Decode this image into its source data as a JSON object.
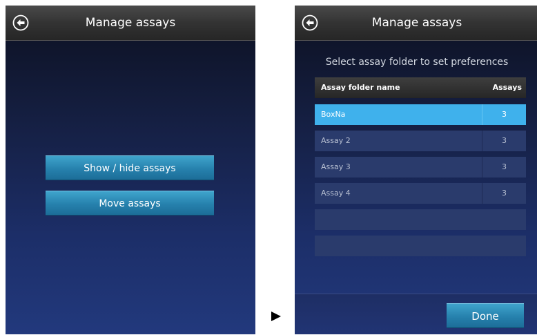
{
  "left_screen": {
    "title": "Manage assays",
    "back_icon": "back-arrow-circle-icon",
    "buttons": [
      {
        "label": "Show / hide assays"
      },
      {
        "label": "Move assays"
      }
    ]
  },
  "flow_arrow_icon": "right-triangle-icon",
  "right_screen": {
    "title": "Manage assays",
    "back_icon": "back-arrow-circle-icon",
    "subtitle": "Select assay folder to set preferences",
    "table": {
      "headers": {
        "name": "Assay folder name",
        "count": "Assays"
      },
      "rows": [
        {
          "name": "BoxNa",
          "count": "3",
          "selected": true
        },
        {
          "name": "Assay 2",
          "count": "3",
          "selected": false
        },
        {
          "name": "Assay 3",
          "count": "3",
          "selected": false
        },
        {
          "name": "Assay 4",
          "count": "3",
          "selected": false
        },
        {
          "name": "",
          "count": "",
          "selected": false
        },
        {
          "name": "",
          "count": "",
          "selected": false
        }
      ]
    },
    "done_label": "Done"
  },
  "colors": {
    "accent_button": "#2681ad",
    "selected_row": "#3fb1ec",
    "row_background": "#2a3b6c",
    "title_bar": "#333333"
  }
}
